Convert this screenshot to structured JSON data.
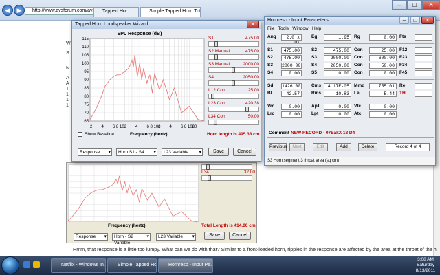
{
  "browser": {
    "address": "http://www.avsforum.com/avs-vb/showthread.php?t=",
    "tabs": [
      "Tapped Hor...",
      "Simple Tapped Horn Tutori..."
    ],
    "article_line": "Hmm, that response is a little too lumpy. What can we do with that? Similar to a front-loaded horn, ripples in the response are affected by the area at the throat of the horn.",
    "left_strip": [
      "W",
      "S",
      "N",
      "A",
      "A",
      "T",
      "1",
      "1",
      "1"
    ]
  },
  "wizard1": {
    "title": "Tapped Horn Loudspeaker Wizard",
    "chart_title": "SPL Response (dB)",
    "show_baseline": "Show Baseline",
    "freq_label": "Frequency (hertz)",
    "horn_length": "Horn length is 495.38 cm",
    "sliders": [
      {
        "label": "S1",
        "value": "475.00",
        "pos": 0.12
      },
      {
        "label": "S2 Manual",
        "value": "475.00",
        "pos": 0.12
      },
      {
        "label": "S3 Manual",
        "value": "2000.00",
        "pos": 0.5
      },
      {
        "label": "S4",
        "value": "2050.00",
        "pos": 0.5
      },
      {
        "label": "L12 Con",
        "value": "25.00",
        "pos": 0.05
      },
      {
        "label": "L23 Con",
        "value": "420.38",
        "pos": 0.8
      },
      {
        "label": "L34 Con",
        "value": "50.00",
        "pos": 0.1
      }
    ],
    "selects": [
      "Response",
      "Horn S1 - S4",
      "L23 Variable"
    ],
    "save": "Save",
    "cancel": "Cancel"
  },
  "wizard2": {
    "freq_label": "Frequency (hertz)",
    "horn_length": "Total Length is 414.00 cm",
    "l34_label": "L34",
    "l34_value": "32.00",
    "selects": [
      "Response",
      "Horn - S2 Variable",
      "L23 Variable"
    ],
    "save": "Save",
    "cancel": "Cancel"
  },
  "chart_data": {
    "type": "line",
    "ylim": [
      65,
      115
    ],
    "yticks": [
      115,
      110,
      105,
      100,
      95,
      90,
      85,
      80,
      75,
      70,
      65
    ],
    "xticks": [
      "2",
      "4",
      "6 8 10",
      "2",
      "4",
      "6 8 100",
      "2",
      "4",
      "6 8 1000",
      "2"
    ],
    "x": [
      10,
      12,
      15,
      18,
      20,
      25,
      30,
      35,
      40,
      45,
      50,
      55,
      60,
      65,
      70,
      75,
      80,
      90,
      100,
      110,
      120,
      140,
      160,
      180,
      200,
      250,
      300,
      400,
      500,
      700,
      1000,
      1500,
      2000
    ],
    "y": [
      66,
      70,
      76,
      82,
      86,
      90,
      92,
      93,
      93,
      94,
      95,
      96,
      97,
      99,
      102,
      98,
      105,
      92,
      100,
      90,
      97,
      88,
      93,
      82,
      94,
      84,
      90,
      78,
      85,
      70,
      74,
      66,
      65
    ],
    "grid": true
  },
  "hornresp": {
    "title": "Hornresp - Input Parameters",
    "menu": [
      "File",
      "Tools",
      "Window",
      "Help"
    ],
    "rows1": [
      {
        "l1": "Ang",
        "v1": "2.0 x Pi",
        "l2": "Eg",
        "v2": "1.95",
        "l3": "Rg",
        "v3": "0.00",
        "l4": "Fta",
        "v4": ""
      }
    ],
    "rows2": [
      {
        "l1": "S1",
        "v1": "475.00",
        "l2": "S2",
        "v2": "475.00",
        "l3": "Con",
        "v3": "25.00",
        "l4": "F12",
        "v4": ""
      },
      {
        "l1": "S2",
        "v1": "475.00",
        "l2": "S3",
        "v2": "2000.00",
        "l3": "Con",
        "v3": "600.00",
        "l4": "F23",
        "v4": ""
      },
      {
        "l1": "S3",
        "v1": "2000.00",
        "l2": "S4",
        "v2": "2050.00",
        "l3": "Con",
        "v3": "50.00",
        "l4": "F34",
        "v4": ""
      },
      {
        "l1": "S4",
        "v1": "0.00",
        "l2": "S5",
        "v2": "0.00",
        "l3": "Con",
        "v3": "0.00",
        "l4": "F45",
        "v4": ""
      }
    ],
    "rows3": [
      {
        "l1": "Sd",
        "v1": "1426.00",
        "l2": "Cms",
        "v2": "4.17E-05",
        "l3": "Mmd",
        "v3": "755.01",
        "l4": "Re",
        "v4": ""
      },
      {
        "l1": "Bl",
        "v1": "42.57",
        "l2": "Rms",
        "v2": "10.83",
        "l3": "Le",
        "v3": "5.44",
        "l4": "TH",
        "v4": ""
      }
    ],
    "rows4": [
      {
        "l1": "Vrc",
        "v1": "0.00",
        "l2": "Ap1",
        "v2": "0.00",
        "l3": "Vtc",
        "v3": "0.00"
      },
      {
        "l1": "Lrc",
        "v1": "0.00",
        "l2": "Lpt",
        "v2": "0.00",
        "l3": "Atc",
        "v3": "0.00"
      }
    ],
    "comment_label": "Comment",
    "comment": "NEW RECORD - 07SakX 18 D4",
    "buttons": [
      "Previous",
      "Next",
      "Edit",
      "Add",
      "Delete"
    ],
    "record": "Record 4 of 4",
    "status": "S3  Horn segment 3 throat area (sq cm)"
  },
  "taskbar": {
    "items": [
      "Netflix - Windows In...",
      "Simple Tapped Hor...",
      "Hornresp - Input Pa..."
    ],
    "time": "3:08 AM",
    "day": "Saturday",
    "date": "8/13/2011"
  }
}
